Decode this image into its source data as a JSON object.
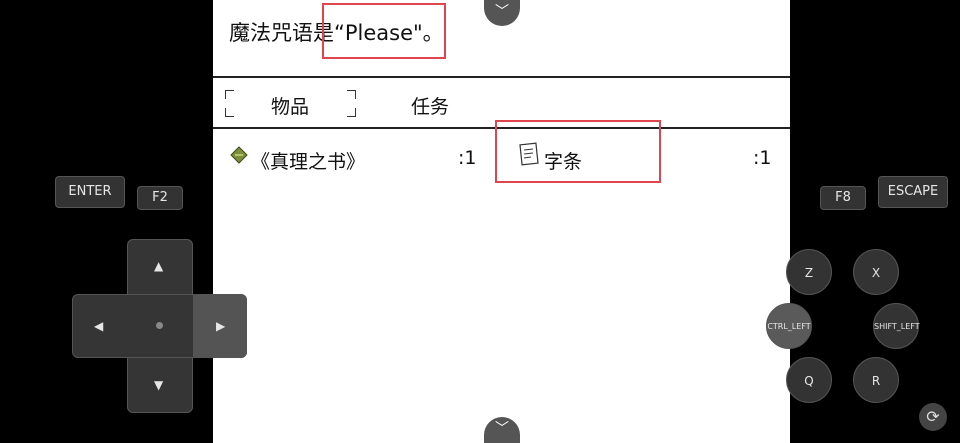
{
  "message": {
    "text": "魔法咒语是“Please\"。"
  },
  "tabs": [
    {
      "label": "物品"
    },
    {
      "label": "任务"
    }
  ],
  "items": [
    {
      "name": "《真理之书》",
      "qty": ":1",
      "icon": "book-icon"
    },
    {
      "name": "字条",
      "qty": ":1",
      "icon": "note-icon"
    }
  ],
  "controls": {
    "enter": "ENTER",
    "f2": "F2",
    "f8": "F8",
    "escape": "ESCAPE",
    "z": "Z",
    "x": "X",
    "ctrl_left": "CTRL_LEFT",
    "shift_left": "SHIFT_LEFT",
    "q": "Q",
    "r": "R"
  },
  "colors": {
    "highlight": "#e0444d"
  }
}
